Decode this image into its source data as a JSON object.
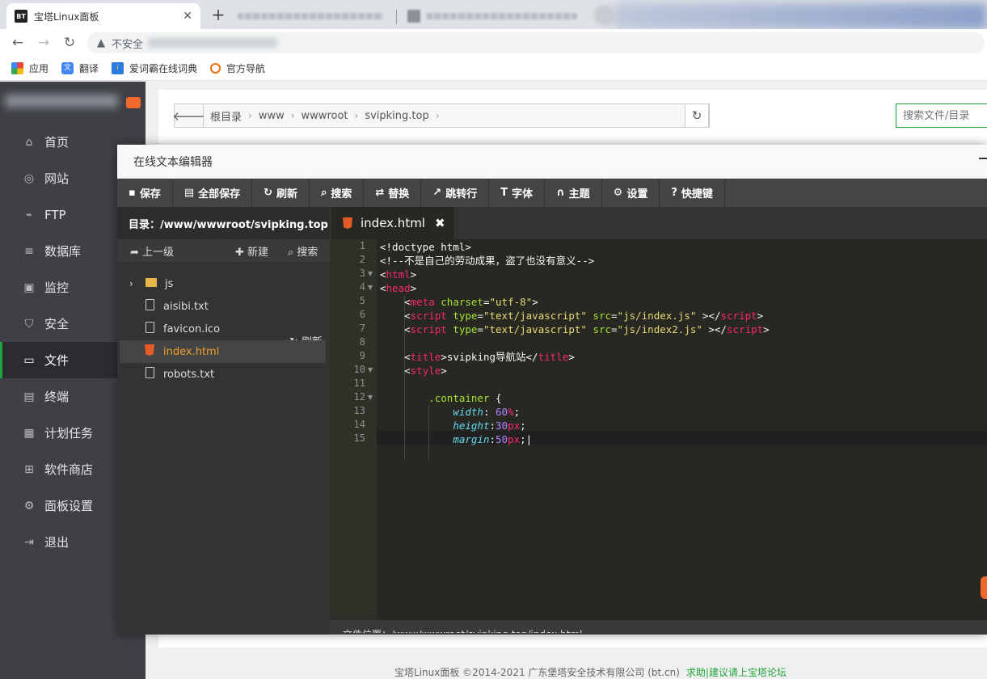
{
  "browser": {
    "active_tab": {
      "title": "宝塔Linux面板",
      "favicon": "BT"
    },
    "address": {
      "security_label": "不安全"
    },
    "bookmarks": [
      "应用",
      "翻译",
      "爱词霸在线词典",
      "官方导航"
    ]
  },
  "sidebar": {
    "items": [
      {
        "label": "首页",
        "icon": "home-icon"
      },
      {
        "label": "网站",
        "icon": "globe-icon"
      },
      {
        "label": "FTP",
        "icon": "ftp-icon"
      },
      {
        "label": "数据库",
        "icon": "database-icon"
      },
      {
        "label": "监控",
        "icon": "monitor-icon"
      },
      {
        "label": "安全",
        "icon": "shield-icon"
      },
      {
        "label": "文件",
        "icon": "folder-icon",
        "active": true
      },
      {
        "label": "终端",
        "icon": "terminal-icon"
      },
      {
        "label": "计划任务",
        "icon": "calendar-icon"
      },
      {
        "label": "软件商店",
        "icon": "grid-icon"
      },
      {
        "label": "面板设置",
        "icon": "gear-icon"
      },
      {
        "label": "退出",
        "icon": "logout-icon"
      }
    ]
  },
  "pathbar": {
    "crumbs": [
      "根目录",
      "www",
      "wwwroot",
      "svipking.top"
    ],
    "search_placeholder": "搜索文件/目录"
  },
  "editor": {
    "title": "在线文本编辑器",
    "toolbar": [
      {
        "label": "保存",
        "icon": "save-icon"
      },
      {
        "label": "全部保存",
        "icon": "save-all-icon"
      },
      {
        "label": "刷新",
        "icon": "refresh-icon"
      },
      {
        "label": "搜索",
        "icon": "search-icon"
      },
      {
        "label": "替换",
        "icon": "replace-icon"
      },
      {
        "label": "跳转行",
        "icon": "jump-icon"
      },
      {
        "label": "字体",
        "icon": "font-icon"
      },
      {
        "label": "主题",
        "icon": "theme-icon"
      },
      {
        "label": "设置",
        "icon": "gear-icon"
      },
      {
        "label": "快捷键",
        "icon": "help-icon"
      }
    ],
    "directory_label": "目录：/www/wwwroot/svipking.top",
    "dir_tools": {
      "up": "上一级",
      "new": "新建",
      "search": "搜索",
      "refresh": "刷新"
    },
    "files": [
      {
        "name": "js",
        "type": "folder"
      },
      {
        "name": "aisibi.txt",
        "type": "file"
      },
      {
        "name": "favicon.ico",
        "type": "file"
      },
      {
        "name": "index.html",
        "type": "html",
        "selected": true
      },
      {
        "name": "robots.txt",
        "type": "file"
      }
    ],
    "open_tab": "index.html",
    "line_numbers": [
      "1",
      "2",
      "3",
      "4",
      "5",
      "6",
      "7",
      "8",
      "9",
      "10",
      "11",
      "12",
      "13",
      "14",
      "15"
    ],
    "code_text": {
      "l1": "<!doctype html>",
      "l2": "<!--不是自己的劳动成果，盗了也没有意义-->",
      "l9_text": "svipking导航站"
    },
    "status": "文件位置：/www/wwwroot/svipking.top/index.html"
  },
  "footer": {
    "copyright": "宝塔Linux面板 ©2014-2021 广东堡塔安全技术有限公司 (bt.cn)",
    "link": "求助|建议请上宝塔论坛"
  }
}
